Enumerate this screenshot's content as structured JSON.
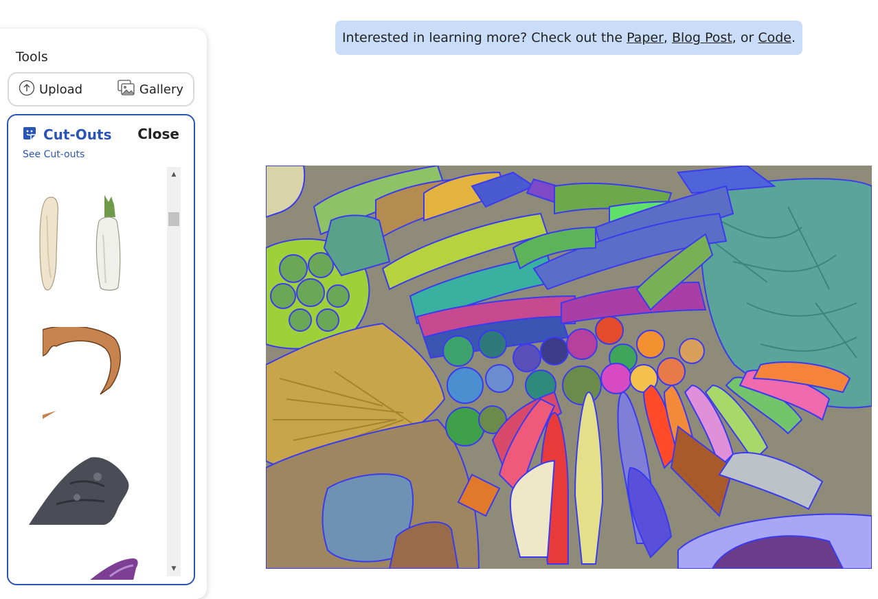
{
  "sidebar": {
    "tools_title": "Tools",
    "upload_label": "Upload",
    "gallery_label": "Gallery",
    "cutouts": {
      "title": "Cut-Outs",
      "close_label": "Close",
      "see_link": "See Cut-outs"
    }
  },
  "banner": {
    "prefix": "Interested in learning more? Check out the ",
    "paper": "Paper",
    "sep1": ", ",
    "blog": "Blog Post",
    "sep2": ", or ",
    "code": "Code",
    "suffix": "."
  },
  "colors": {
    "accent": "#2b55b5",
    "banner_bg": "#c9dcf8",
    "mask_outline": "#3a3af0"
  }
}
